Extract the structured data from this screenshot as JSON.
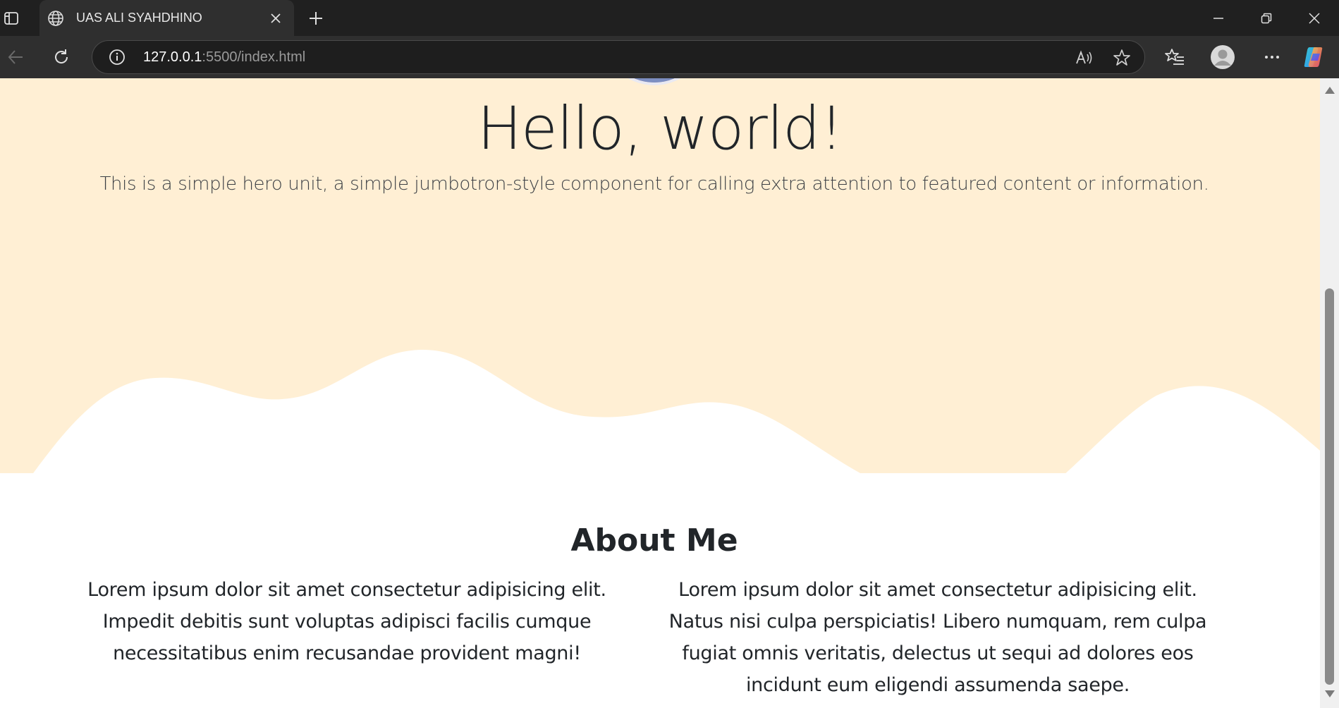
{
  "browser": {
    "tab": {
      "title": "UAS ALI SYAHDHINO",
      "favicon": "globe-icon"
    },
    "address": {
      "host": "127.0.0.1",
      "path": ":5500/index.html"
    },
    "colors": {
      "chrome_bg": "#202020",
      "tab_bg": "#2f2f2f",
      "omnibox_bg": "#1e1e1e"
    }
  },
  "page": {
    "hero": {
      "title": "Hello, world!",
      "lead": "This is a simple hero unit, a simple jumbotron-style component for calling extra attention to featured content or information.",
      "bg_color": "#ffefd4"
    },
    "about": {
      "heading": "About Me",
      "col1": "Lorem ipsum dolor sit amet consectetur adipisicing elit. Impedit debitis sunt voluptas adipisci facilis cumque necessitatibus enim recusandae provident magni!",
      "col2": "Lorem ipsum dolor sit amet consectetur adipisicing elit. Natus nisi culpa perspiciatis! Libero numquam, rem culpa fugiat omnis veritatis, delectus ut sequi ad dolores eos incidunt eum eligendi assumenda saepe."
    }
  }
}
